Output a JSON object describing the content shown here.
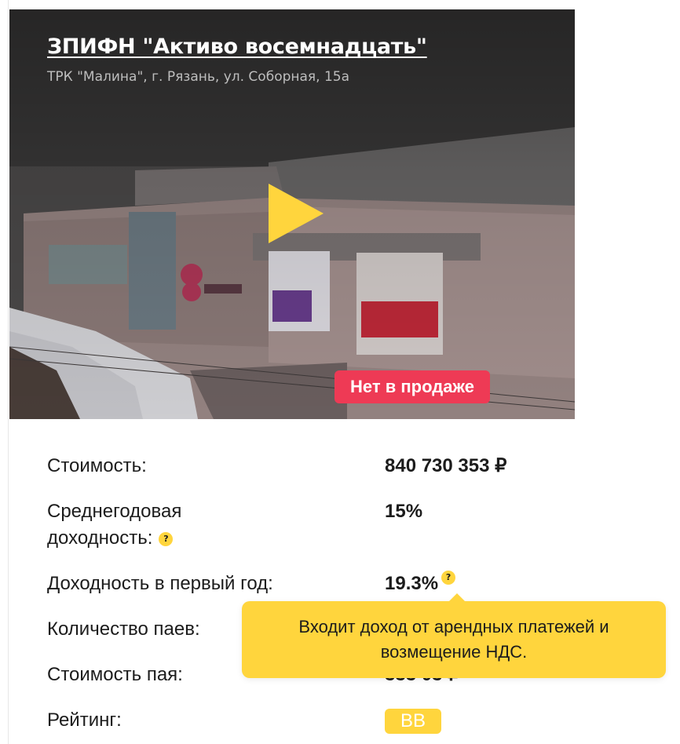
{
  "fund": {
    "title": "ЗПИФН \"Активо восемнадцать\"",
    "address": "ТРК \"Малина\", г. Рязань, ул. Соборная, 15а",
    "status_badge": "Нет в продаже"
  },
  "details": {
    "cost_label": "Стоимость:",
    "cost_value": "840 730 353 ₽",
    "avg_yield_label_line1": "Среднегодовая",
    "avg_yield_label_line2": "доходность:",
    "avg_yield_value": "15%",
    "first_year_label": "Доходность в первый год:",
    "first_year_value": "19.3%",
    "shares_count_label": "Количество паев:",
    "share_cost_label": "Стоимость пая:",
    "share_cost_value_partial": "333 03 ₽",
    "rating_label": "Рейтинг:",
    "rating_value": "BB"
  },
  "help_icon": "?",
  "tooltip": {
    "text": "Входит доход от арендных платежей и возмещение НДС."
  },
  "colors": {
    "accent_yellow": "#ffd53d",
    "badge_red": "#ee3a55",
    "text": "#1c1c1c"
  },
  "icons": {
    "play": "play-icon",
    "help": "question-icon"
  }
}
